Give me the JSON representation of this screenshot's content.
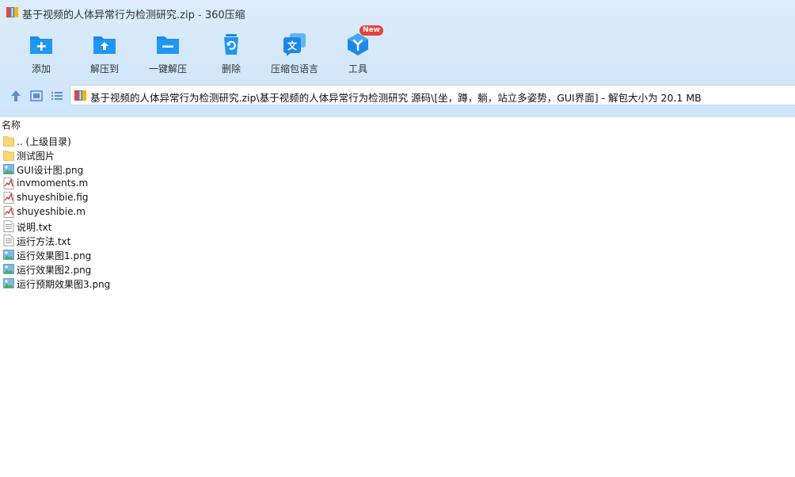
{
  "window": {
    "title": "基于视频的人体异常行为检测研究.zip",
    "separator": "-",
    "app_name": "360压缩"
  },
  "toolbar": {
    "buttons": [
      {
        "label": "添加",
        "icon": "add-folder-icon"
      },
      {
        "label": "解压到",
        "icon": "extract-to-icon"
      },
      {
        "label": "一键解压",
        "icon": "one-click-extract-icon"
      },
      {
        "label": "删除",
        "icon": "recycle-bin-icon"
      },
      {
        "label": "压缩包语言",
        "icon": "language-icon"
      },
      {
        "label": "工具",
        "icon": "tools-cube-icon",
        "badge": "New"
      }
    ]
  },
  "nav": {
    "path": "基于视频的人体异常行为检测研究.zip\\基于视频的人体异常行为检测研究 源码\\[坐，蹲，躺，站立多姿势，GUI界面] - 解包大小为 20.1 MB"
  },
  "list": {
    "column_name": "名称",
    "items": [
      {
        "name": ".. (上级目录)",
        "type": "folder"
      },
      {
        "name": "测试图片",
        "type": "folder"
      },
      {
        "name": "GUI设计图.png",
        "type": "image"
      },
      {
        "name": "invmoments.m",
        "type": "matlab"
      },
      {
        "name": "shuyeshibie.fig",
        "type": "matlab"
      },
      {
        "name": "shuyeshibie.m",
        "type": "matlab"
      },
      {
        "name": "说明.txt",
        "type": "text"
      },
      {
        "name": "运行方法.txt",
        "type": "text"
      },
      {
        "name": "运行效果图1.png",
        "type": "image"
      },
      {
        "name": "运行效果图2.png",
        "type": "image"
      },
      {
        "name": "运行预期效果图3.png",
        "type": "image"
      }
    ]
  },
  "colors": {
    "toolbar_bg": "#d4e8fb",
    "icon_blue": "#1e88e5",
    "badge_red": "#e8413b"
  }
}
